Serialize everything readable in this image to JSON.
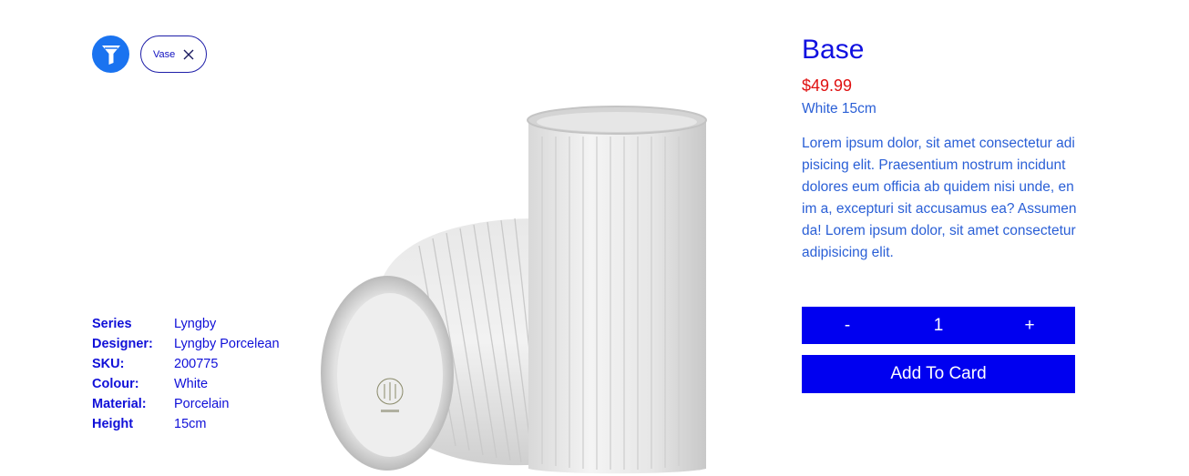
{
  "filter": {
    "icon": "funnel-icon",
    "chip_label": "Vase",
    "chip_close_icon": "close-icon"
  },
  "specs": [
    {
      "key": "Series",
      "value": "Lyngby"
    },
    {
      "key": "Designer:",
      "value": "Lyngby Porcelean"
    },
    {
      "key": "SKU:",
      "value": "200775"
    },
    {
      "key": "Colour:",
      "value": "White"
    },
    {
      "key": "Material:",
      "value": "Porcelain"
    },
    {
      "key": "Height",
      "value": "15cm"
    }
  ],
  "product": {
    "title": "Base",
    "price": "$49.99",
    "variant": "White 15cm",
    "description": "Lorem ipsum dolor, sit amet consectetur adipisicing elit. Praesentium nostrum incidunt dolores eum officia ab quidem nisi unde, enim a, excepturi sit accusamus ea? Assumenda! Lorem ipsum dolor, sit amet consectetur adipisicing elit.",
    "image_alt": "vase-image"
  },
  "quantity": {
    "minus_label": "-",
    "value": "1",
    "plus_label": "+"
  },
  "add_button_label": "Add To Card",
  "colors": {
    "accent": "#0000f0",
    "filter_icon_bg": "#1a73f0",
    "price": "#e01010",
    "text_blue": "#2a5fd6"
  }
}
